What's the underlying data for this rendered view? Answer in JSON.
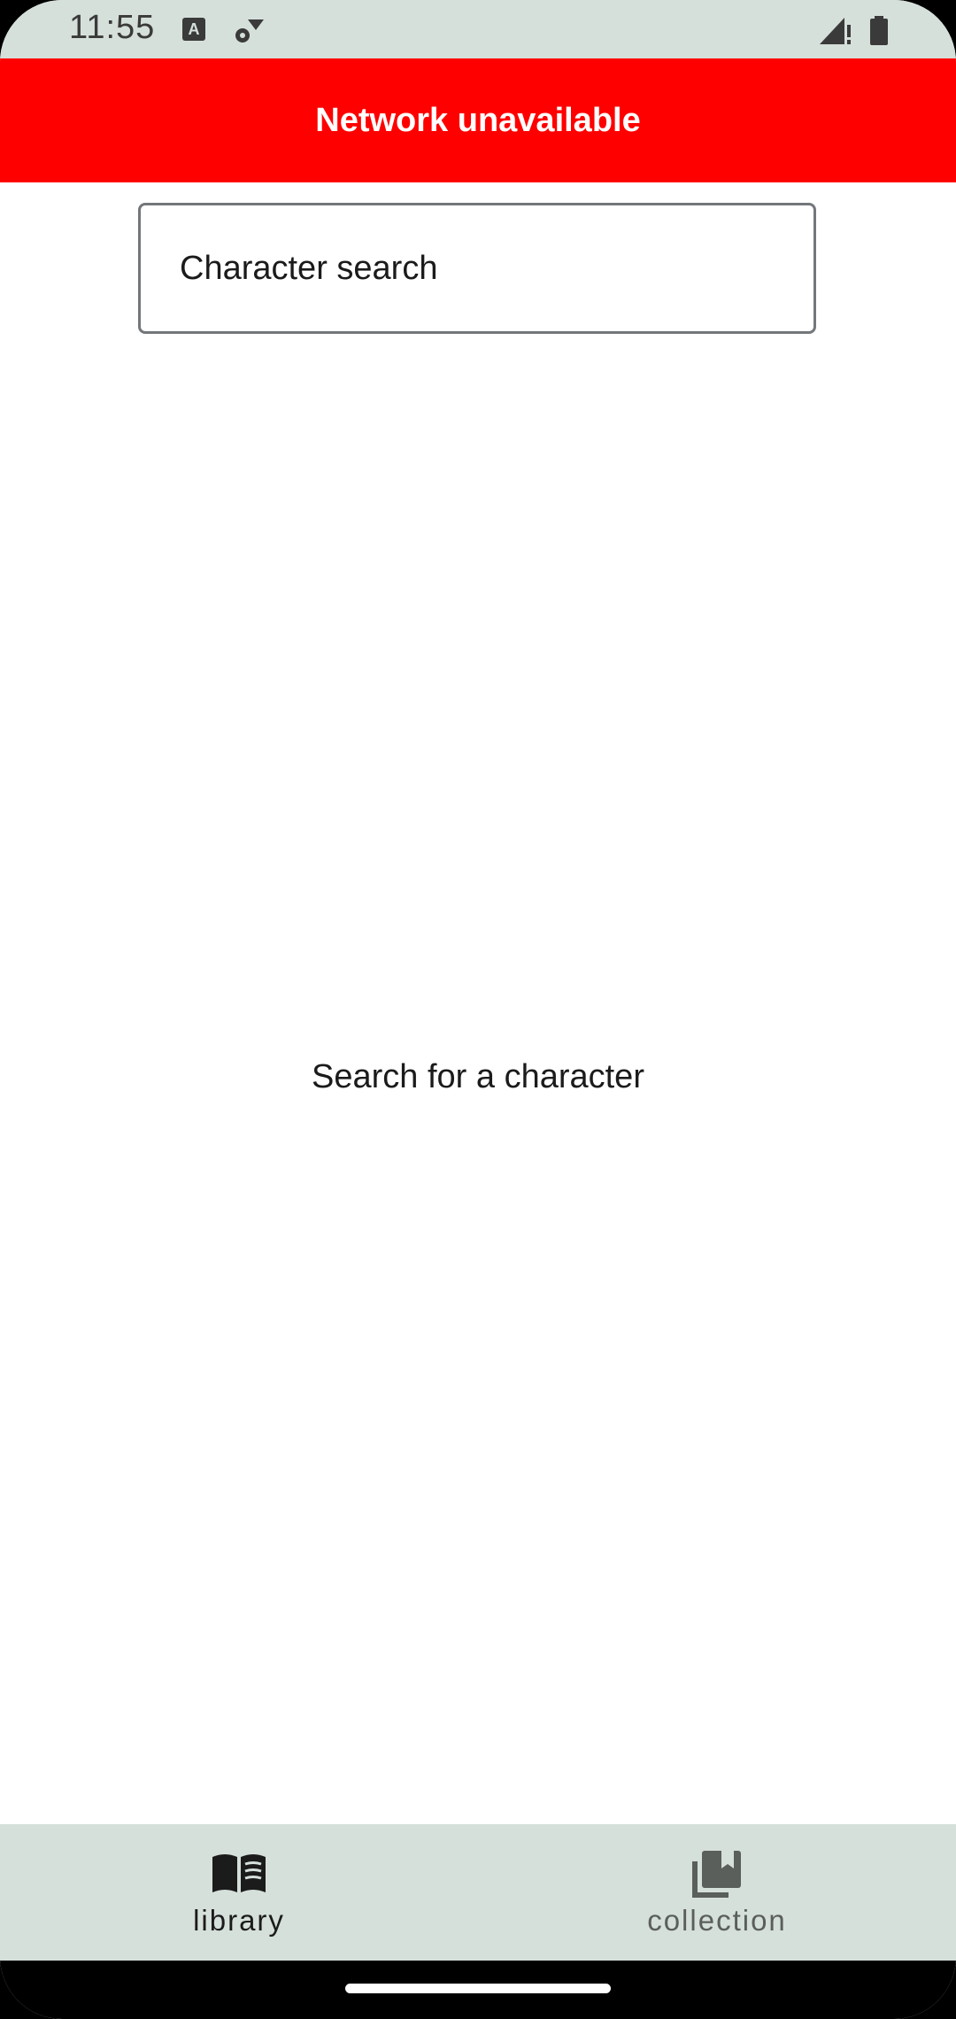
{
  "status_bar": {
    "time": "11:55",
    "icons": [
      "keyboard-a-icon",
      "settings-wifi-icon",
      "signal-alert-icon",
      "battery-icon"
    ]
  },
  "banner": {
    "text": "Network unavailable",
    "color": "#ff0000"
  },
  "search": {
    "placeholder": "Character search",
    "value": ""
  },
  "main": {
    "empty_message": "Search for a character"
  },
  "bottom_nav": {
    "items": [
      {
        "label": "library",
        "icon": "book-open-icon",
        "active": true
      },
      {
        "label": "collection",
        "icon": "bookmark-collection-icon",
        "active": false
      }
    ]
  },
  "colors": {
    "bar_background": "#d6e0db",
    "accent_banner": "#ff0000"
  }
}
